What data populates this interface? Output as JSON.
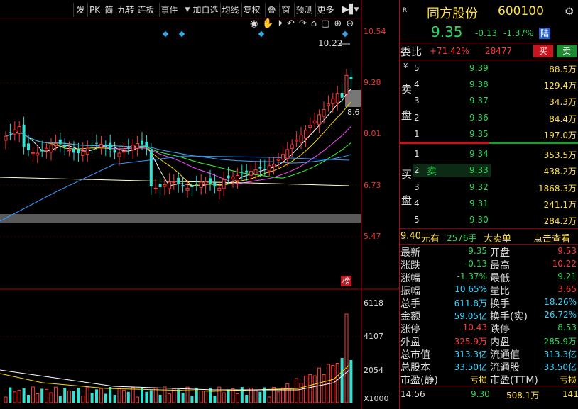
{
  "toolbar": {
    "items": [
      "发",
      "PK",
      "简",
      "九转",
      "连板",
      "事件",
      "加自选",
      "均线",
      "复权",
      "叠",
      "窗",
      "预测",
      "更多"
    ]
  },
  "chart": {
    "price_labels": [
      "10.54",
      "9.28",
      "8.01",
      "6.73",
      "5.47"
    ],
    "high_label": "10.22",
    "low_label": "8.6",
    "volume_labels": [
      "6118",
      "4107",
      "2054"
    ],
    "volume_unit": "X1000",
    "tag": "榜"
  },
  "stock": {
    "name": "同方股份",
    "code": "600100",
    "price": "9.35",
    "change": "-0.13",
    "pct": "-1.37%",
    "board": "陆"
  },
  "ratio": {
    "label": "委比",
    "value": "+71.42%",
    "diff": "28477",
    "buy_label": "买",
    "sell_label": "卖"
  },
  "sell_side": {
    "label": [
      "卖",
      "盘"
    ],
    "yen": "¥",
    "rows": [
      {
        "n": "5",
        "price": "9.39",
        "vol": "88.5万"
      },
      {
        "n": "4",
        "price": "9.38",
        "vol": "129.4万"
      },
      {
        "n": "3",
        "price": "9.37",
        "vol": "34.3万"
      },
      {
        "n": "2",
        "price": "9.36",
        "vol": "84.4万"
      },
      {
        "n": "1",
        "price": "9.35",
        "vol": "197.0万"
      }
    ]
  },
  "buy_side": {
    "label": [
      "买",
      "盘"
    ],
    "rows": [
      {
        "n": "1",
        "price": "9.34",
        "vol": "353.5万",
        "tag": ""
      },
      {
        "n": "2",
        "price": "9.33",
        "vol": "438.2万",
        "tag": "卖"
      },
      {
        "n": "3",
        "price": "9.32",
        "vol": "1868.3万",
        "tag": ""
      },
      {
        "n": "4",
        "price": "9.31",
        "vol": "241.1万",
        "tag": ""
      },
      {
        "n": "5",
        "price": "9.30",
        "vol": "284.2万",
        "tag": ""
      }
    ]
  },
  "big_order": {
    "price": "9.40",
    "unit1": "元有",
    "amount": "2576手",
    "label": "大卖单",
    "link": "点击查看"
  },
  "stats": [
    {
      "l1": "最新",
      "v1": "9.35",
      "l2": "开盘",
      "v2": "9.53"
    },
    {
      "l1": "涨跌",
      "v1": "-0.13",
      "l2": "最高",
      "v2": "10.22"
    },
    {
      "l1": "涨幅",
      "v1": "-1.37%",
      "l2": "最低",
      "v2": "9.21"
    },
    {
      "l1": "振幅",
      "v1": "10.65%",
      "l2": "量比",
      "v2": "3.65"
    },
    {
      "l1": "总手",
      "v1": "611.8万",
      "l2": "换手",
      "v2": "18.26%"
    },
    {
      "l1": "金额",
      "v1": "59.05亿",
      "l2": "换手(实)",
      "v2": "26.72%"
    },
    {
      "l1": "涨停",
      "v1": "10.43",
      "l2": "跌停",
      "v2": "8.53"
    },
    {
      "l1": "外盘",
      "v1": "325.9万",
      "l2": "内盘",
      "v2": "285.9万"
    },
    {
      "l1": "总市值",
      "v1": "313.3亿",
      "l2": "流通值",
      "v2": "313.3亿"
    },
    {
      "l1": "总股本",
      "v1": "33.50亿",
      "l2": "流通股",
      "v2": "33.50亿"
    },
    {
      "l1": "市盈(静)",
      "v1": "亏损",
      "l2": "市盈(TTM)",
      "v2": "亏损"
    }
  ],
  "tick": {
    "time": "14:56",
    "price": "9.30",
    "vol": "508.1万",
    "num": "141"
  }
}
